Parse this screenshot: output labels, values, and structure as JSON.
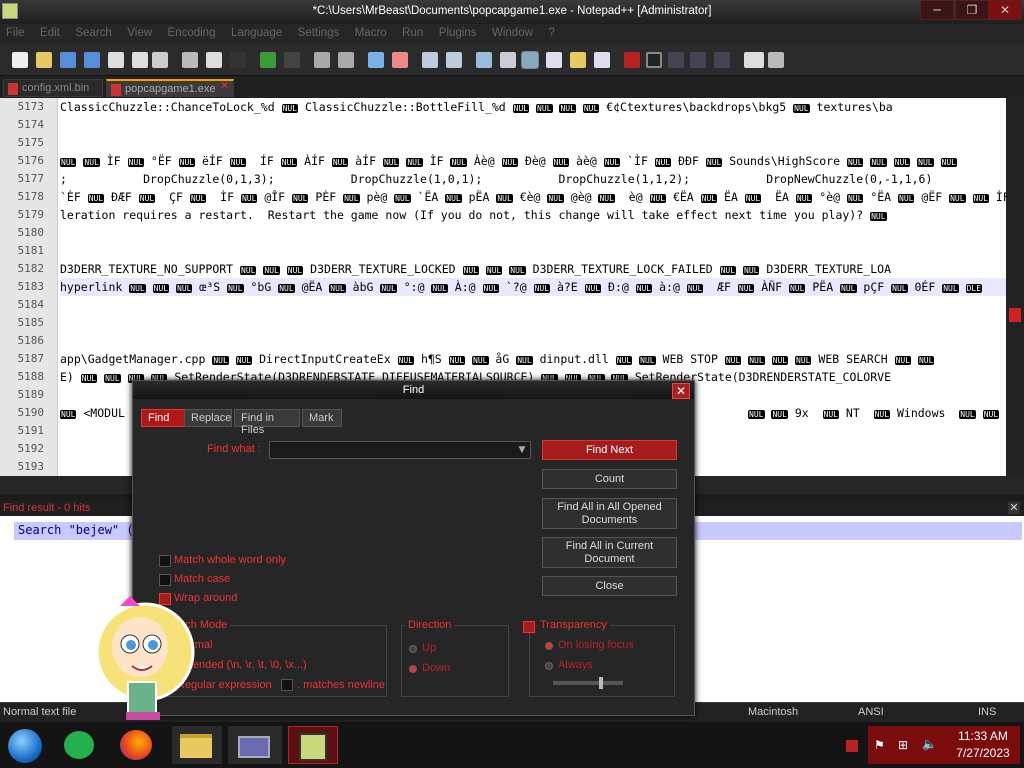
{
  "window": {
    "title": "*C:\\Users\\MrBeast\\Documents\\popcapgame1.exe - Notepad++ [Administrator]"
  },
  "menu": [
    "File",
    "Edit",
    "Search",
    "View",
    "Encoding",
    "Language",
    "Settings",
    "Macro",
    "Run",
    "Plugins",
    "Window",
    "?"
  ],
  "tabs": [
    {
      "label": "config.xml.bin"
    },
    {
      "label": "popcapgame1.exe"
    }
  ],
  "editor": {
    "lines": [
      {
        "num": "5173",
        "text": "ClassicChuzzle::ChanceToLock_%d NUL ClassicChuzzle::BottleFill_%d NUL NUL NUL NUL €¢Ctextures\\backdrops\\bkg5 NUL textures\\ba"
      },
      {
        "num": "5174",
        "text": ""
      },
      {
        "num": "5175",
        "text": ""
      },
      {
        "num": "5176",
        "text": "NUL NUL ÌF NUL °ËF NUL ëÍF NUL  ÍF NUL ÀÍF NUL àÍF NUL NUL ÌF NUL Àè@ NUL Ðè@ NUL àè@ NUL `ÌF NUL ÐÐF NUL Sounds\\HighScore NUL NUL NUL NUL NUL"
      },
      {
        "num": "5177",
        "text": ";           DropChuzzle(0,1,3);           DropChuzzle(1,0,1);           DropChuzzle(1,1,2);           DropNewChuzzle(0,-1,1,6)"
      },
      {
        "num": "5178",
        "text": "`ÈF NUL ÐÆF NUL  ÇF NUL  ÌF NUL @ÎF NUL PÈF NUL pè@ NUL `ËA NUL pËA NUL €è@ NUL @è@ NUL  è@ NUL €ËA NUL ËA NUL  ËA NUL °è@ NUL °ËA NUL @ËF NUL NUL ÌF"
      },
      {
        "num": "5179",
        "text": "leration requires a restart.  Restart the game now (If you do not, this change will take effect next time you play)? NUL"
      },
      {
        "num": "5180",
        "text": ""
      },
      {
        "num": "5181",
        "text": ""
      },
      {
        "num": "5182",
        "text": "D3DERR_TEXTURE_NO_SUPPORT NUL NUL NUL D3DERR_TEXTURE_LOCKED NUL NUL NUL D3DERR_TEXTURE_LOCK_FAILED NUL NUL D3DERR_TEXTURE_LOA"
      },
      {
        "num": "5183",
        "text": "hyperlink NUL NUL NUL œ³S NUL °bG NUL @ËA NUL àbG NUL °:@ NUL À:@ NUL `?@ NUL à?E NUL Ð:@ NUL à:@ NUL  ÆF NUL ÀÑF NUL PËA NUL pÇF NUL 0ÉF NUL DLE"
      },
      {
        "num": "5184",
        "text": ""
      },
      {
        "num": "5185",
        "text": ""
      },
      {
        "num": "5186",
        "text": ""
      },
      {
        "num": "5187",
        "text": "app\\GadgetManager.cpp NUL NUL DirectInputCreateEx NUL h¶S NUL NUL åG NUL dinput.dll NUL NUL WEB STOP NUL NUL NUL NUL WEB SEARCH NUL NUL"
      },
      {
        "num": "5188",
        "text": "E) NUL NUL NUL NUL SetRenderState(D3DRENDERSTATE_DIFFUSEMATERIALSOURCE) NUL NUL NUL NUL SetRenderState(D3DRENDERSTATE_COLORVE"
      },
      {
        "num": "5189",
        "text": ""
      },
      {
        "num": "5190",
        "text": "NUL <MODUL                                                                                          NUL NUL 9x  NUL NT  NUL Windows  NUL NUL NUL N"
      },
      {
        "num": "5191",
        "text": ""
      },
      {
        "num": "5192",
        "text": ""
      },
      {
        "num": "5193",
        "text": ""
      }
    ]
  },
  "find_result": {
    "header": "Find result - 0 hits",
    "line": "Search \"bejew\" (0 hits in 1 file of 1 searched)"
  },
  "status": {
    "type": "Normal text file",
    "eol": "Macintosh",
    "encoding": "ANSI",
    "mode": "INS"
  },
  "clock": {
    "time": "11:33 AM",
    "date": "7/27/2023"
  },
  "dialog": {
    "title": "Find",
    "tabs": [
      "Find",
      "Replace",
      "Find in Files",
      "Mark"
    ],
    "find_what_label": "Find what :",
    "find_what_value": "",
    "buttons": {
      "find_next": "Find Next",
      "count": "Count",
      "find_all_opened": "Find All in All Opened Documents",
      "find_all_current": "Find All in Current Document",
      "close": "Close"
    },
    "options": {
      "match_whole_word": "Match whole word only",
      "match_case": "Match case",
      "wrap_around": "Wrap around"
    },
    "search_mode": {
      "title": "Search Mode",
      "normal": "Normal",
      "extended": "Extended (\\n, \\r, \\t, \\0, \\x...)",
      "regex": "Regular expression",
      "matches_newline": ". matches newline"
    },
    "direction": {
      "title": "Direction",
      "up": "Up",
      "down": "Down"
    },
    "transparency": {
      "title": "Transparency",
      "on_losing_focus": "On losing focus",
      "always": "Always",
      "level": 0.7
    }
  },
  "colors": {
    "accent": "#b01818",
    "selection": "#c9c9ff",
    "nul_bg": "#000000"
  }
}
